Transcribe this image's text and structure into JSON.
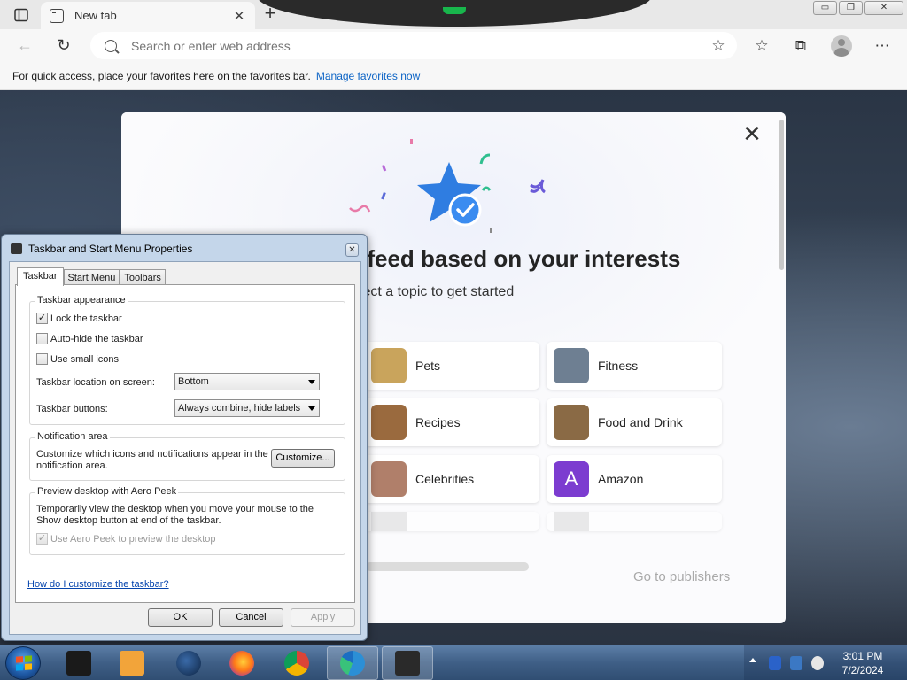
{
  "browser": {
    "tab_title": "New tab",
    "tab_close": "✕",
    "new_tab": "+",
    "address_placeholder": "Search or enter web address",
    "favorites_prompt": "For quick access, place your favorites here on the favorites bar.",
    "favorites_link": "Manage favorites now",
    "window_controls": [
      "▭",
      "❐",
      "✕"
    ],
    "icons": {
      "back": "←",
      "refresh": "↻",
      "add_favorite": "☆",
      "favorites": "☆",
      "collections": "⧉",
      "more": "⋯"
    }
  },
  "feed_modal": {
    "heading": "r feed based on your interests",
    "subheading": "elect a topic to get started",
    "close": "✕",
    "topics": [
      {
        "label": "Pets",
        "color": "#c9a45c"
      },
      {
        "label": "Fitness",
        "color": "#6e7f92"
      },
      {
        "label": "Recipes",
        "color": "#9a6a3e"
      },
      {
        "label": "Food and Drink",
        "color": "#8a6a45"
      },
      {
        "label": "Celebrities",
        "color": "#b07f6a"
      },
      {
        "label": "Amazon",
        "letter": "A",
        "color": "#7c3cd0"
      }
    ],
    "publishers_link": "Go to publishers"
  },
  "dialog": {
    "title": "Taskbar and Start Menu Properties",
    "close": "✕",
    "tabs": [
      "Taskbar",
      "Start Menu",
      "Toolbars"
    ],
    "appearance": {
      "title": "Taskbar appearance",
      "lock_label": "Lock the taskbar",
      "lock_checked": true,
      "autohide_label": "Auto-hide the taskbar",
      "autohide_checked": false,
      "small_icons_label": "Use small icons",
      "small_icons_checked": false,
      "location_label": "Taskbar location on screen:",
      "location_value": "Bottom",
      "buttons_label": "Taskbar buttons:",
      "buttons_value": "Always combine, hide labels"
    },
    "notification": {
      "title": "Notification area",
      "text_line1": "Customize which icons and notifications appear in the",
      "text_line2": "notification area.",
      "customize_button": "Customize..."
    },
    "aero_peek": {
      "title": "Preview desktop with Aero Peek",
      "text_line1": "Temporarily view the desktop when you move your mouse to the",
      "text_line2": "Show desktop button at end of the taskbar.",
      "checkbox_label": "Use Aero Peek to preview the desktop",
      "checked": true
    },
    "help_link": "How do I customize the taskbar?",
    "buttons": {
      "ok": "OK",
      "cancel": "Cancel",
      "apply": "Apply"
    }
  },
  "taskbar": {
    "apps": [
      {
        "name": "taskbar-app-generic",
        "color": "#1a1a1a"
      },
      {
        "name": "taskbar-app-media",
        "color": "#f2a43a"
      },
      {
        "name": "taskbar-app-globe",
        "color": "#1f3f6e"
      },
      {
        "name": "taskbar-app-firefox",
        "color": "#ff7a18"
      },
      {
        "name": "taskbar-app-chrome",
        "color": "#dd4b39"
      },
      {
        "name": "taskbar-app-edge",
        "color": "#2b8fd6"
      },
      {
        "name": "taskbar-app-window",
        "color": "#2a2a2a"
      }
    ],
    "clock_time": "3:01 PM",
    "clock_date": "7/2/2024"
  }
}
